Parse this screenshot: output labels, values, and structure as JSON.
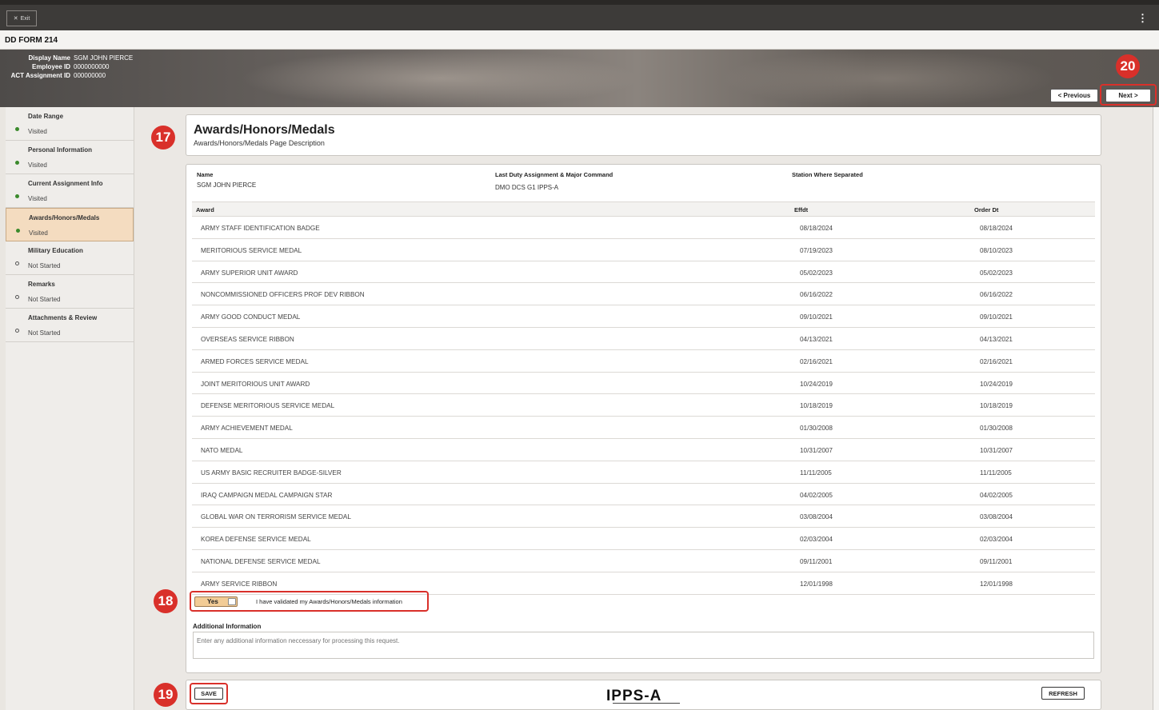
{
  "topbar": {
    "exit_label": "Exit",
    "exit_icon": "close-icon",
    "menu_icon": "more-vertical-icon",
    "menu_glyph": "⋮"
  },
  "form": {
    "title": "DD FORM 214"
  },
  "employee": {
    "display_name_label": "Display Name",
    "display_name": "SGM JOHN PIERCE",
    "employee_id_label": "Employee ID",
    "employee_id": "0000000000",
    "assignment_id_label": "ACT Assignment ID",
    "assignment_id": "000000000"
  },
  "nav": {
    "previous_label": "< Previous",
    "next_label": "Next >"
  },
  "badges": {
    "b17": "17",
    "b18": "18",
    "b19": "19",
    "b20": "20",
    "color": "#d9302a"
  },
  "sidebar": {
    "steps": [
      {
        "title": "Date Range",
        "status": "Visited",
        "state": "visited"
      },
      {
        "title": "Personal Information",
        "status": "Visited",
        "state": "visited"
      },
      {
        "title": "Current Assignment Info",
        "status": "Visited",
        "state": "visited"
      },
      {
        "title": "Awards/Honors/Medals",
        "status": "Visited",
        "state": "visited",
        "active": true
      },
      {
        "title": "Military Education",
        "status": "Not Started",
        "state": "not-started"
      },
      {
        "title": "Remarks",
        "status": "Not Started",
        "state": "not-started"
      },
      {
        "title": "Attachments & Review",
        "status": "Not Started",
        "state": "not-started"
      }
    ]
  },
  "page": {
    "title": "Awards/Honors/Medals",
    "description": "Awards/Honors/Medals Page Description"
  },
  "header_fields": {
    "name_label": "Name",
    "name_value": "SGM JOHN PIERCE",
    "duty_label": "Last Duty Assignment & Major Command",
    "duty_value": "DMO DCS G1 IPPS-A",
    "station_label": "Station Where Separated",
    "station_value": ""
  },
  "awards_table": {
    "columns": [
      "Award",
      "Effdt",
      "Order Dt"
    ],
    "rows": [
      [
        "ARMY STAFF IDENTIFICATION BADGE",
        "08/18/2024",
        "08/18/2024"
      ],
      [
        "MERITORIOUS SERVICE MEDAL",
        "07/19/2023",
        "08/10/2023"
      ],
      [
        "ARMY SUPERIOR UNIT AWARD",
        "05/02/2023",
        "05/02/2023"
      ],
      [
        "NONCOMMISSIONED OFFICERS PROF DEV RIBBON",
        "06/16/2022",
        "06/16/2022"
      ],
      [
        "ARMY GOOD CONDUCT MEDAL",
        "09/10/2021",
        "09/10/2021"
      ],
      [
        "OVERSEAS SERVICE RIBBON",
        "04/13/2021",
        "04/13/2021"
      ],
      [
        "ARMED FORCES SERVICE MEDAL",
        "02/16/2021",
        "02/16/2021"
      ],
      [
        "JOINT MERITORIOUS UNIT AWARD",
        "10/24/2019",
        "10/24/2019"
      ],
      [
        "DEFENSE MERITORIOUS SERVICE MEDAL",
        "10/18/2019",
        "10/18/2019"
      ],
      [
        "ARMY ACHIEVEMENT MEDAL",
        "01/30/2008",
        "01/30/2008"
      ],
      [
        "NATO MEDAL",
        "10/31/2007",
        "10/31/2007"
      ],
      [
        "US ARMY BASIC RECRUITER BADGE-SILVER",
        "11/11/2005",
        "11/11/2005"
      ],
      [
        "IRAQ CAMPAIGN MEDAL CAMPAIGN STAR",
        "04/02/2005",
        "04/02/2005"
      ],
      [
        "GLOBAL WAR ON TERRORISM SERVICE MEDAL",
        "03/08/2004",
        "03/08/2004"
      ],
      [
        "KOREA DEFENSE SERVICE MEDAL",
        "02/03/2004",
        "02/03/2004"
      ],
      [
        "NATIONAL DEFENSE SERVICE MEDAL",
        "09/11/2001",
        "09/11/2001"
      ],
      [
        "ARMY SERVICE RIBBON",
        "12/01/1998",
        "12/01/1998"
      ]
    ]
  },
  "validation": {
    "toggle_label": "Yes",
    "checked": true,
    "text": "I have validated my Awards/Honors/Medals information"
  },
  "additional_info": {
    "label": "Additional Information",
    "placeholder": "Enter any additional information neccessary for processing this request."
  },
  "footer": {
    "save_label": "SAVE",
    "refresh_label": "REFRESH",
    "logo_text": "IPPS-A"
  },
  "colors": {
    "accent": "#f4dcc0",
    "toggle": "#f2cc96",
    "visited_dot": "#3b8a2c"
  }
}
